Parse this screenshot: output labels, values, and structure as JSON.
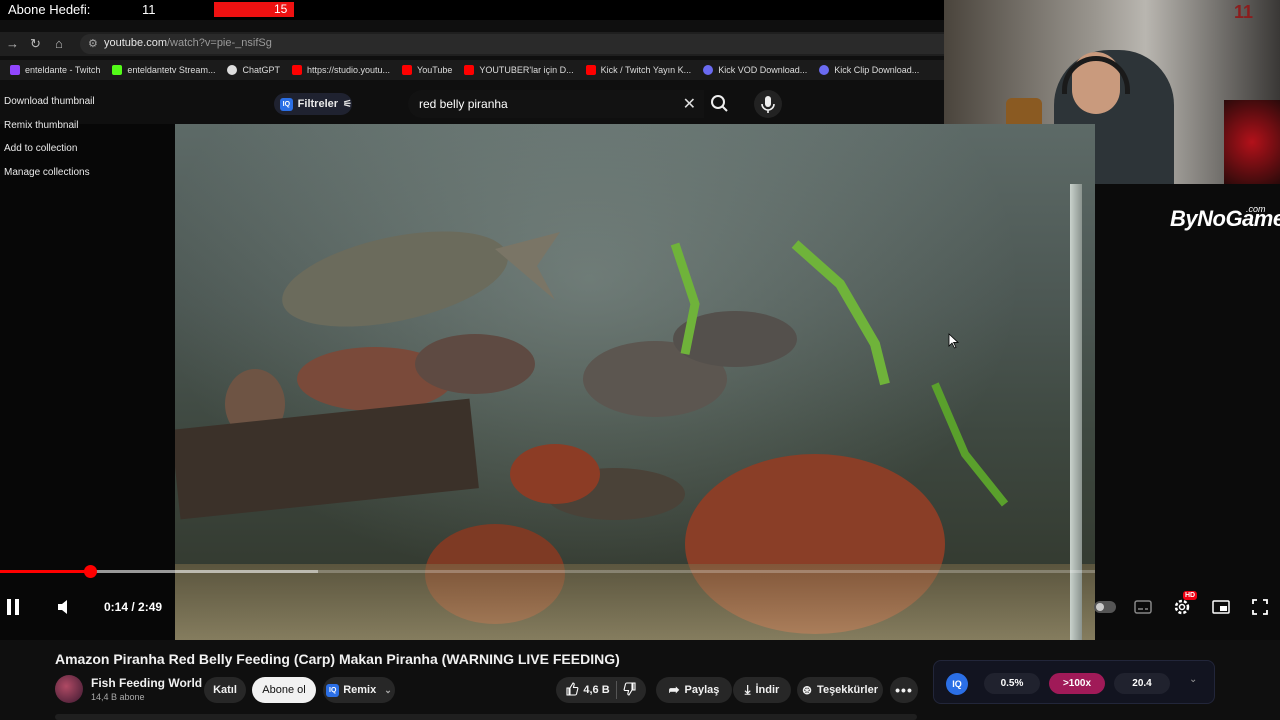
{
  "stream_overlay": {
    "goal_label": "Abone Hedefi:",
    "goal_current": "11",
    "goal_target": "15",
    "colors": {
      "goal_bar": "#ee1111"
    }
  },
  "browser": {
    "url_domain": "youtube.com",
    "url_path": "/watch?v=pie-_nsifSg",
    "nav_icons": [
      "forward-icon",
      "reload-icon",
      "home-icon",
      "site-settings-icon"
    ],
    "bookmarks": [
      {
        "label": "enteldante - Twitch",
        "icon": "twitch-icon",
        "color": "#9146ff"
      },
      {
        "label": "enteldantetv Stream...",
        "icon": "kick-icon",
        "color": "#53fc18"
      },
      {
        "label": "ChatGPT",
        "icon": "chatgpt-icon",
        "color": "#dddddd"
      },
      {
        "label": "https://studio.youtu...",
        "icon": "youtube-icon",
        "color": "#ff0000"
      },
      {
        "label": "YouTube",
        "icon": "youtube-icon",
        "color": "#ff0000"
      },
      {
        "label": "YOUTUBER'lar için D...",
        "icon": "youtube-icon",
        "color": "#ff0000"
      },
      {
        "label": "Kick / Twitch Yayın K...",
        "icon": "youtube-icon",
        "color": "#ff0000"
      },
      {
        "label": "Kick VOD Download...",
        "icon": "globe-icon",
        "color": "#6a6af0"
      },
      {
        "label": "Kick Clip Download...",
        "icon": "globe-icon",
        "color": "#6a6af0"
      }
    ]
  },
  "thumbnail_menu": {
    "items": [
      "Download thumbnail",
      "Remix thumbnail",
      "Add to collection",
      "Manage collections"
    ]
  },
  "search": {
    "filter_label": "Filtreler",
    "query": "red belly piranha",
    "icons": [
      "close-icon",
      "search-icon",
      "microphone-icon"
    ]
  },
  "branding": {
    "logo_text": "ByNoGame",
    "logo_suffix": ".com",
    "webcam_corner_digits": "11"
  },
  "player": {
    "time_current": "0:14",
    "time_total": "2:49",
    "time_display": "0:14 / 2:49",
    "progress_fraction": 0.083,
    "buffered_fraction": 0.29,
    "state": "playing",
    "hd_badge": "HD",
    "accent": "#ff0000"
  },
  "video": {
    "title": "Amazon Piranha Red Belly Feeding (Carp) Makan Piranha (WARNING LIVE FEEDING)",
    "channel_name": "Fish Feeding World",
    "channel_subs": "14,4 B abone",
    "join_label": "Katıl",
    "subscribe_label": "Abone ol",
    "remix_label": "Remix",
    "like_count": "4,6 B",
    "share_label": "Paylaş",
    "download_label": "İndir",
    "thanks_label": "Teşekkürler"
  },
  "iq_widget": {
    "badge": "IQ",
    "stat_1": "0.5%",
    "stat_2": ">100x",
    "stat_3": "20.4",
    "colors": {
      "hot": "#a01a58"
    }
  }
}
